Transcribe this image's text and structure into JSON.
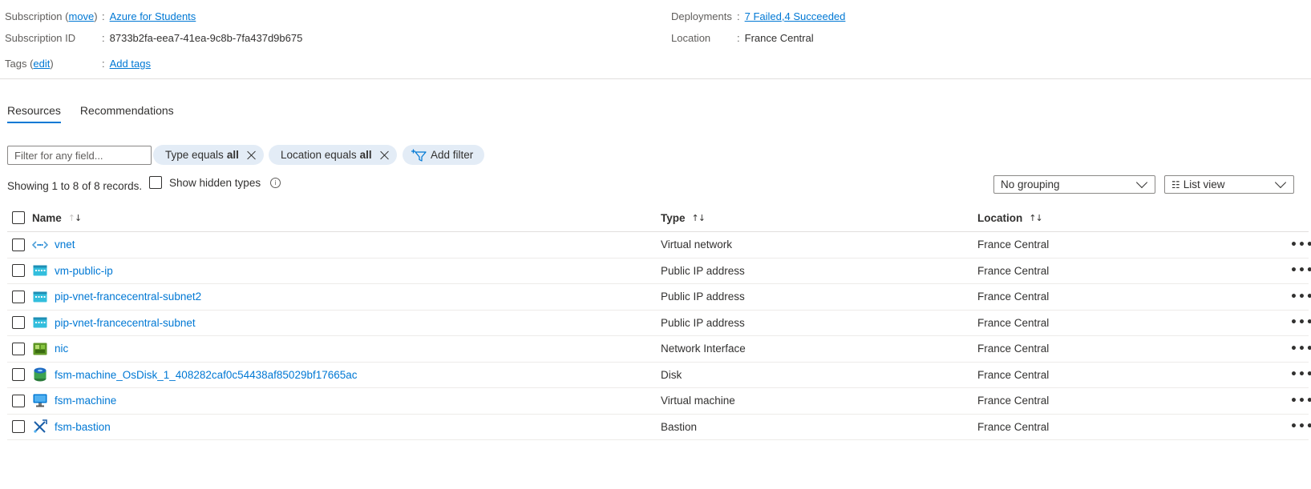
{
  "essentials": {
    "subscription_label": "Subscription",
    "subscription_move": "move",
    "subscription_value": "Azure for Students",
    "subscription_id_label": "Subscription ID",
    "subscription_id_value": "8733b2fa-eea7-41ea-9c8b-7fa437d9b675",
    "tags_label": "Tags",
    "tags_edit": "edit",
    "tags_value": "Add tags",
    "deployments_label": "Deployments",
    "deployments_failed": "7 Failed",
    "deployments_sep": ",",
    "deployments_succeeded": "4 Succeeded",
    "location_label": "Location",
    "location_value": "France Central",
    "colon": ":"
  },
  "tabs": [
    {
      "label": "Resources",
      "active": true
    },
    {
      "label": "Recommendations",
      "active": false
    }
  ],
  "filter": {
    "placeholder": "Filter for any field...",
    "pills": [
      {
        "prefix": "Type equals",
        "value": "all"
      },
      {
        "prefix": "Location equals",
        "value": "all"
      }
    ],
    "add_filter_label": "Add filter"
  },
  "records_text": "Showing 1 to 8 of 8 records.",
  "show_hidden_label": "Show hidden types",
  "grouping": {
    "value": "No grouping"
  },
  "view": {
    "value": "List view"
  },
  "table": {
    "columns": {
      "name": "Name",
      "type": "Type",
      "location": "Location"
    },
    "rows": [
      {
        "name": "vnet",
        "type": "Virtual network",
        "location": "France Central",
        "icon": "virtual-network-icon"
      },
      {
        "name": "vm-public-ip",
        "type": "Public IP address",
        "location": "France Central",
        "icon": "public-ip-icon"
      },
      {
        "name": "pip-vnet-francecentral-subnet2",
        "type": "Public IP address",
        "location": "France Central",
        "icon": "public-ip-icon"
      },
      {
        "name": "pip-vnet-francecentral-subnet",
        "type": "Public IP address",
        "location": "France Central",
        "icon": "public-ip-icon"
      },
      {
        "name": "nic",
        "type": "Network Interface",
        "location": "France Central",
        "icon": "network-interface-icon"
      },
      {
        "name": "fsm-machine_OsDisk_1_408282caf0c54438af85029bf17665ac",
        "type": "Disk",
        "location": "France Central",
        "icon": "disk-icon"
      },
      {
        "name": "fsm-machine",
        "type": "Virtual machine",
        "location": "France Central",
        "icon": "virtual-machine-icon"
      },
      {
        "name": "fsm-bastion",
        "type": "Bastion",
        "location": "France Central",
        "icon": "bastion-icon"
      }
    ]
  },
  "more_glyph": "•••",
  "colors": {
    "accent": "#0078d4",
    "pill_bg": "#e3ecf6",
    "text": "#323130"
  }
}
